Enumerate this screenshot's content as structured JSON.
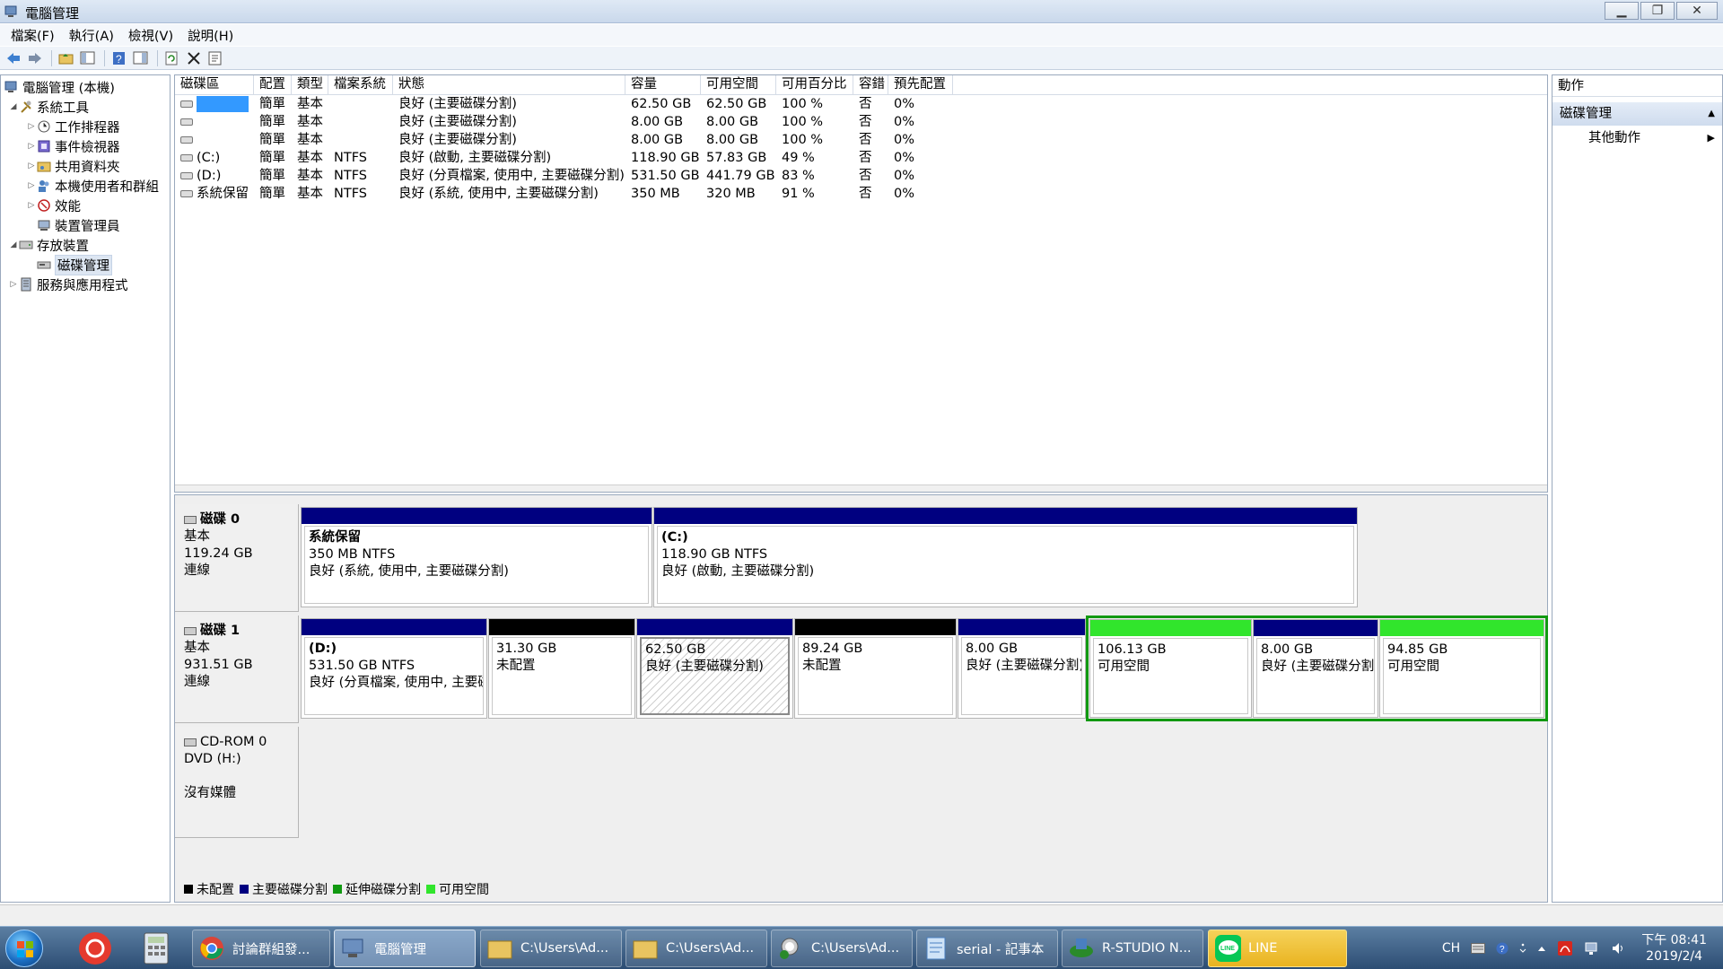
{
  "window": {
    "title": "電腦管理"
  },
  "menu": [
    "檔案(F)",
    "執行(A)",
    "檢視(V)",
    "說明(H)"
  ],
  "tree": {
    "root": "電腦管理 (本機)",
    "system_tools": "系統工具",
    "task_scheduler": "工作排程器",
    "event_viewer": "事件檢視器",
    "shared_folders": "共用資料夾",
    "local_users": "本機使用者和群組",
    "performance": "效能",
    "device_manager": "裝置管理員",
    "storage": "存放裝置",
    "disk_management": "磁碟管理",
    "services": "服務與應用程式"
  },
  "columns": [
    "磁碟區",
    "配置",
    "類型",
    "檔案系統",
    "狀態",
    "容量",
    "可用空間",
    "可用百分比",
    "容錯",
    "預先配置"
  ],
  "volumes": [
    [
      "",
      "簡單",
      "基本",
      "",
      "良好 (主要磁碟分割)",
      "62.50 GB",
      "62.50 GB",
      "100 %",
      "否",
      "0%"
    ],
    [
      "",
      "簡單",
      "基本",
      "",
      "良好 (主要磁碟分割)",
      "8.00 GB",
      "8.00 GB",
      "100 %",
      "否",
      "0%"
    ],
    [
      "",
      "簡單",
      "基本",
      "",
      "良好 (主要磁碟分割)",
      "8.00 GB",
      "8.00 GB",
      "100 %",
      "否",
      "0%"
    ],
    [
      "(C:)",
      "簡單",
      "基本",
      "NTFS",
      "良好 (啟動, 主要磁碟分割)",
      "118.90 GB",
      "57.83 GB",
      "49 %",
      "否",
      "0%"
    ],
    [
      "(D:)",
      "簡單",
      "基本",
      "NTFS",
      "良好 (分頁檔案, 使用中, 主要磁碟分割)",
      "531.50 GB",
      "441.79 GB",
      "83 %",
      "否",
      "0%"
    ],
    [
      "系統保留",
      "簡單",
      "基本",
      "NTFS",
      "良好 (系統, 使用中, 主要磁碟分割)",
      "350 MB",
      "320 MB",
      "91 %",
      "否",
      "0%"
    ]
  ],
  "disks": {
    "disk0": {
      "name": "磁碟 0",
      "type": "基本",
      "size": "119.24 GB",
      "status": "連線"
    },
    "disk1": {
      "name": "磁碟 1",
      "type": "基本",
      "size": "931.51 GB",
      "status": "連線"
    },
    "cdrom": {
      "name": "CD-ROM 0",
      "type": "DVD (H:)",
      "status": "沒有媒體"
    }
  },
  "partitions": {
    "d0p1": {
      "l1": "系統保留",
      "l2": "350 MB NTFS",
      "l3": "良好 (系統, 使用中, 主要磁碟分割)"
    },
    "d0p2": {
      "l1": "(C:)",
      "l2": "118.90 GB NTFS",
      "l3": "良好 (啟動, 主要磁碟分割)"
    },
    "d1p1": {
      "l1": "(D:)",
      "l2": "531.50 GB NTFS",
      "l3": "良好 (分頁檔案, 使用中, 主要磁碟分割)"
    },
    "d1p2": {
      "l1": "31.30 GB",
      "l2": "未配置"
    },
    "d1p3": {
      "l1": "62.50 GB",
      "l2": "良好 (主要磁碟分割)"
    },
    "d1p4": {
      "l1": "89.24 GB",
      "l2": "未配置"
    },
    "d1p5": {
      "l1": "8.00 GB",
      "l2": "良好 (主要磁碟分割)"
    },
    "d1p6": {
      "l1": "106.13 GB",
      "l2": "可用空間"
    },
    "d1p7": {
      "l1": "8.00 GB",
      "l2": "良好 (主要磁碟分割)"
    },
    "d1p8": {
      "l1": "94.85 GB",
      "l2": "可用空間"
    }
  },
  "legend": [
    "未配置",
    "主要磁碟分割",
    "延伸磁碟分割",
    "可用空間"
  ],
  "colors": {
    "unallocated": "#000000",
    "primary": "#000080",
    "extended": "#119911",
    "free": "#31e52c"
  },
  "actions": {
    "header": "動作",
    "section": "磁碟管理",
    "more": "其他動作"
  },
  "taskbar": {
    "tasks": [
      "討論群組發...",
      "電腦管理",
      "C:\\Users\\Ad...",
      "C:\\Users\\Ad...",
      "C:\\Users\\Ad...",
      "serial - 記事本",
      "R-STUDIO N...",
      "LINE"
    ],
    "lang": "CH",
    "time": "下午 08:41",
    "date": "2019/2/4"
  }
}
